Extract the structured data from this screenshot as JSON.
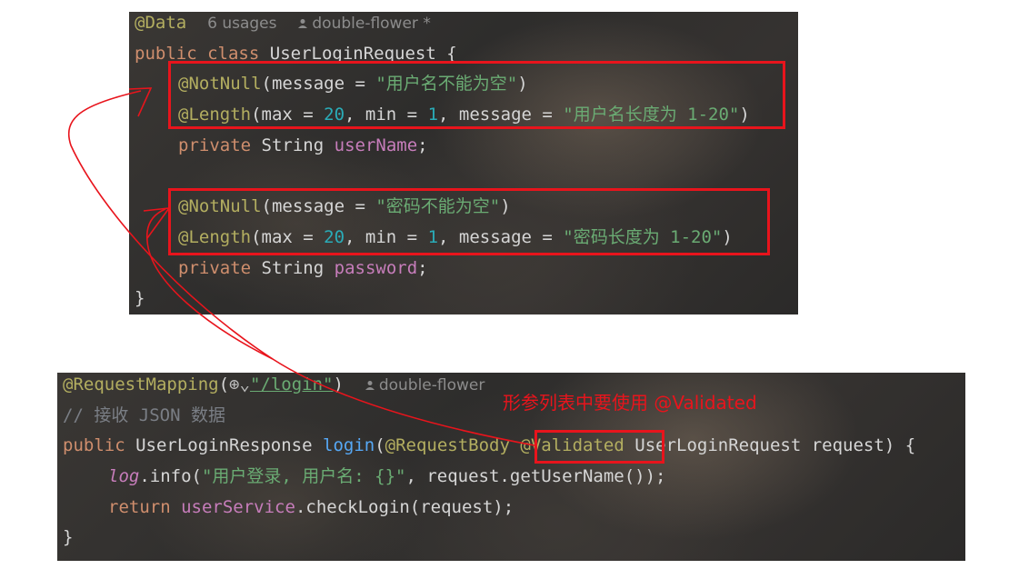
{
  "top_snippet": {
    "header": {
      "annotation": "@Data",
      "usages": "6 usages",
      "author": "double-flower *"
    },
    "class_decl": {
      "kw1": "public",
      "kw2": "class",
      "name": "UserLoginRequest",
      "brace": "{"
    },
    "username_block": {
      "notnull_ann": "@NotNull",
      "notnull_open": "(message = ",
      "notnull_msg": "\"用户名不能为空\"",
      "notnull_close": ")",
      "length_ann": "@Length",
      "length_open": "(max = ",
      "max": "20",
      "mid1": ", min = ",
      "min": "1",
      "mid2": ", message = ",
      "length_msg": "\"用户名长度为 1-20\"",
      "length_close": ")",
      "field_kw": "private",
      "field_type": "String",
      "field_name": "userName",
      "semi": ";"
    },
    "password_block": {
      "notnull_ann": "@NotNull",
      "notnull_open": "(message = ",
      "notnull_msg": "\"密码不能为空\"",
      "notnull_close": ")",
      "length_ann": "@Length",
      "length_open": "(max = ",
      "max": "20",
      "mid1": ", min = ",
      "min": "1",
      "mid2": ", message = ",
      "length_msg": "\"密码长度为 1-20\"",
      "length_close": ")",
      "field_kw": "private",
      "field_type": "String",
      "field_name": "password",
      "semi": ";"
    },
    "close": "}"
  },
  "bottom_snippet": {
    "mapping": {
      "annotation": "@RequestMapping",
      "open": "(",
      "globe": "⊕",
      "chevron": "⌄",
      "path": "\"/login\"",
      "close": ")",
      "author": "double-flower"
    },
    "comment": "// 接收 JSON 数据",
    "signature": {
      "kw": "public",
      "type": "UserLoginResponse",
      "method": "login",
      "open": "(",
      "body_ann": "@RequestBody",
      "validated_ann": "@Validated",
      "param_type": "UserLoginRequest",
      "param_name": "request",
      "close": ") {"
    },
    "log_line": {
      "obj": "log",
      "call": ".info(",
      "msg": "\"用户登录, 用户名: {}\"",
      "rest": ", request.getUserName());"
    },
    "return_line": {
      "kw": "return",
      "obj": "userService",
      "rest": ".checkLogin(request);"
    },
    "close": "}"
  },
  "callout_text": "形参列表中要使用 @Validated",
  "colors": {
    "annotation": "#b3ae60",
    "keyword": "#cf8e6d",
    "string": "#6aab73",
    "number": "#2aacb8",
    "field": "#c77dbb",
    "method": "#56a8f5",
    "highlight": "#e8141c"
  },
  "icons": [
    "user-icon",
    "globe-icon",
    "chevron-down-icon"
  ]
}
